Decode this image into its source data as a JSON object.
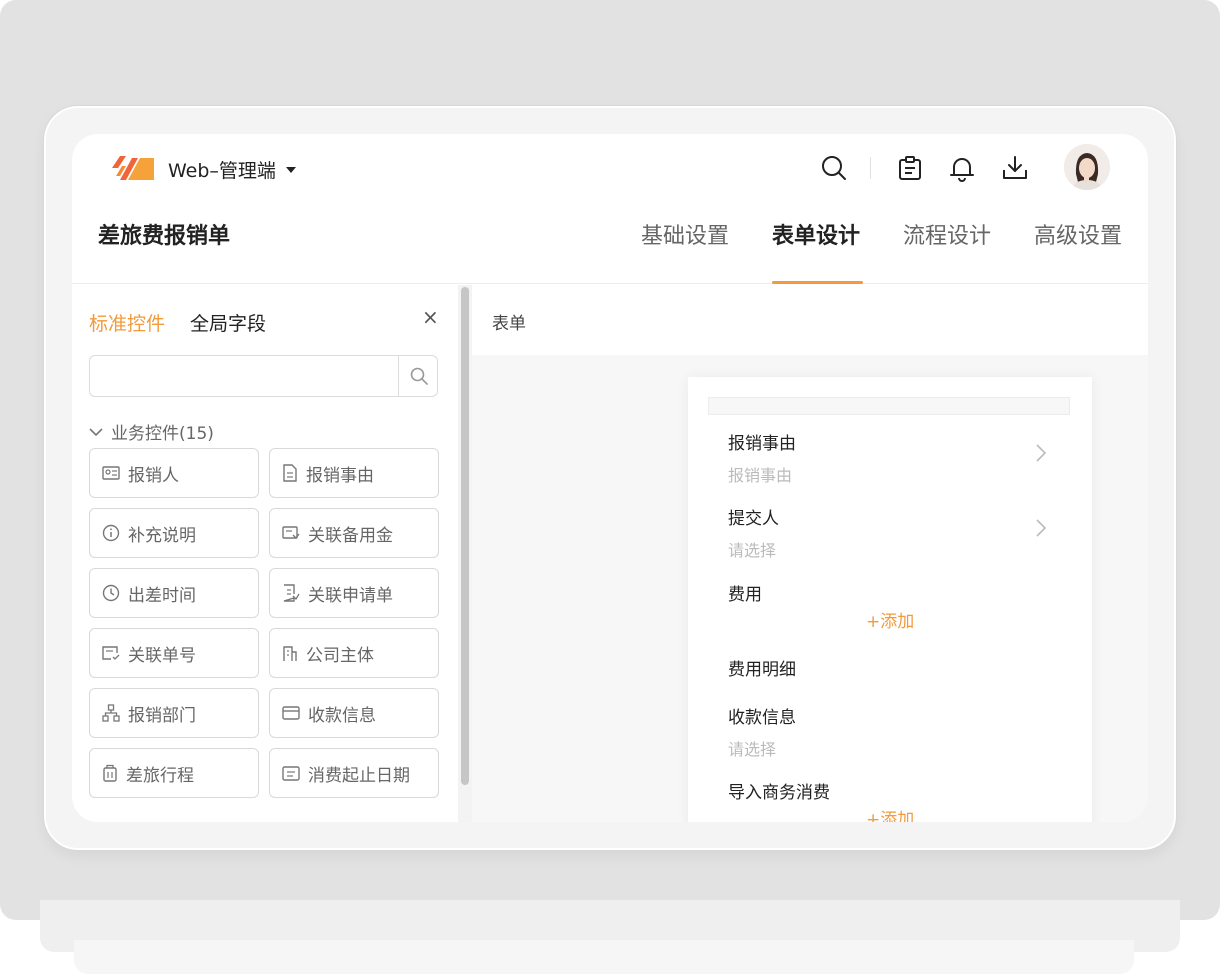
{
  "app": {
    "name": "Web–管理端"
  },
  "page": {
    "title": "差旅费报销单"
  },
  "tabs": [
    {
      "label": "基础设置",
      "active": false
    },
    {
      "label": "表单设计",
      "active": true
    },
    {
      "label": "流程设计",
      "active": false
    },
    {
      "label": "高级设置",
      "active": false
    }
  ],
  "toolbar_icons": [
    "search-icon",
    "clipboard-icon",
    "bell-icon",
    "download-icon"
  ],
  "left_panel": {
    "tabs": [
      {
        "label": "标准控件",
        "active": true
      },
      {
        "label": "全局字段",
        "active": false
      }
    ],
    "close_label": "×",
    "search": {
      "value": "",
      "placeholder": ""
    },
    "group": {
      "label": "业务控件(15)",
      "expanded": true
    },
    "controls": [
      {
        "label": "报销人",
        "icon": "id-card-icon"
      },
      {
        "label": "报销事由",
        "icon": "document-icon"
      },
      {
        "label": "补充说明",
        "icon": "info-icon"
      },
      {
        "label": "关联备用金",
        "icon": "money-link-icon"
      },
      {
        "label": "出差时间",
        "icon": "clock-icon"
      },
      {
        "label": "关联申请单",
        "icon": "form-link-icon"
      },
      {
        "label": "关联单号",
        "icon": "receipt-icon"
      },
      {
        "label": "公司主体",
        "icon": "building-icon"
      },
      {
        "label": "报销部门",
        "icon": "org-chart-icon"
      },
      {
        "label": "收款信息",
        "icon": "card-icon"
      },
      {
        "label": "差旅行程",
        "icon": "luggage-icon"
      },
      {
        "label": "消费起止日期",
        "icon": "calendar-icon"
      }
    ]
  },
  "form_area": {
    "header": "表单",
    "fields": [
      {
        "label": "报销事由",
        "sub": "报销事由"
      },
      {
        "label": "提交人",
        "sub": "请选择"
      },
      {
        "label": "费用",
        "add": "+添加"
      },
      {
        "label": "费用明细"
      },
      {
        "label": "收款信息",
        "sub": "请选择"
      },
      {
        "label": "导入商务消费",
        "add": "+添加"
      }
    ]
  },
  "colors": {
    "accent": "#f39a3a",
    "text": "#222222",
    "muted": "#666666",
    "placeholder": "#bbbbbb"
  }
}
